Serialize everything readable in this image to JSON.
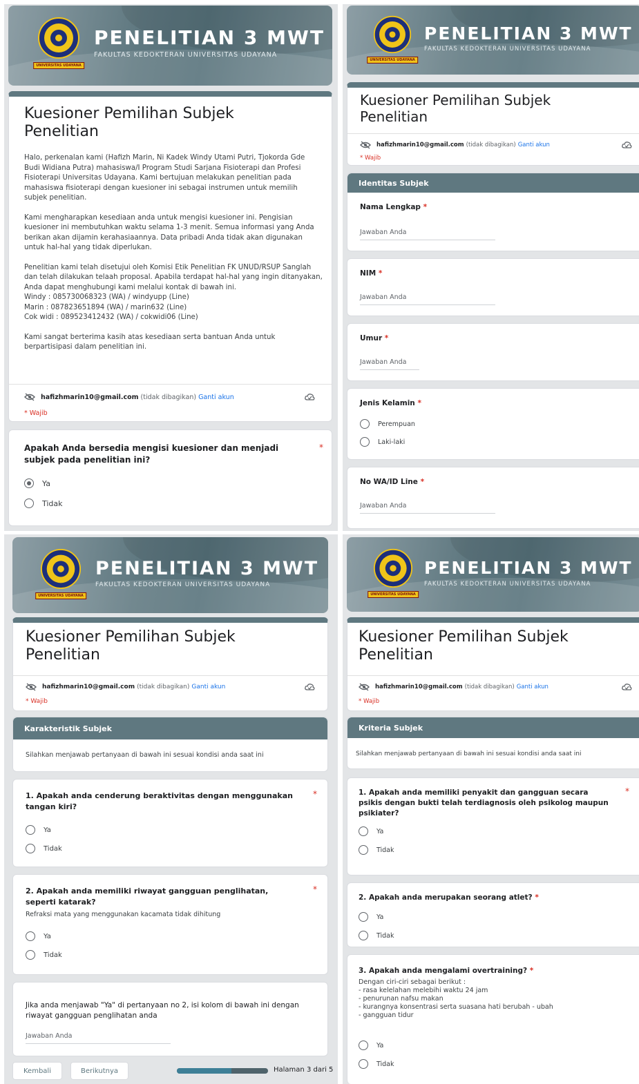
{
  "banner": {
    "title": "PENELITIAN 3 MWT",
    "subtitle": "FAKULTAS KEDOKTERAN UNIVERSITAS UDAYANA",
    "logo_caption": "UNIVERSITAS UDAYANA"
  },
  "form": {
    "title_line1": "Kuesioner Pemilihan Subjek",
    "title_line2": "Penelitian",
    "description": [
      "Halo, perkenalan kami (Hafizh Marin, Ni Kadek Windy Utami Putri, Tjokorda Gde Budi Widiana Putra) mahasiswa/I Program Studi Sarjana Fisioterapi dan Profesi Fisioterapi Universitas Udayana. Kami bertujuan melakukan penelitian pada mahasiswa fisioterapi dengan kuesioner ini sebagai instrumen untuk memilih subjek penelitian.",
      "Kami mengharapkan kesediaan anda untuk mengisi kuesioner ini. Pengisian kuesioner ini membutuhkan waktu selama 1-3 menit. Semua informasi yang Anda berikan akan dijamin kerahasiaannya. Data pribadi Anda tidak akan digunakan untuk hal-hal yang tidak diperlukan.",
      "Penelitian kami telah disetujui oleh Komisi Etik Penelitian FK UNUD/RSUP Sanglah dan telah dilakukan telaah proposal. Apabila terdapat hal-hal yang ingin ditanyakan, Anda dapat menghubungi kami melalui kontak di bawah ini.",
      "Kami sangat berterima kasih atas kesediaan serta bantuan Anda untuk berpartisipasi dalam penelitian ini."
    ],
    "contacts": [
      "Windy : 085730068323 (WA) / windyupp (Line)",
      "Marin : 087823651894 (WA) / marin632 (Line)",
      "Cok widi : 089523412432 (WA) / cokwidi06 (Line)"
    ]
  },
  "account": {
    "email": "hafizhmarin10@gmail.com",
    "not_shared": "(tidak dibagikan)",
    "switch_link": "Ganti akun",
    "required_note": "* Wajib"
  },
  "common": {
    "answer_placeholder": "Jawaban Anda",
    "opt_yes": "Ya",
    "opt_no": "Tidak",
    "req_mark": "*"
  },
  "page1": {
    "consent_question": "Apakah Anda bersedia mengisi kuesioner dan menjadi subjek pada penelitian ini?",
    "selected": "Ya"
  },
  "page2": {
    "section": "Identitas Subjek",
    "fields": [
      {
        "label": "Nama Lengkap"
      },
      {
        "label": "NIM"
      },
      {
        "label": "Umur"
      },
      {
        "label": "Jenis Kelamin",
        "options": [
          "Perempuan",
          "Laki-laki"
        ]
      },
      {
        "label": "No WA/ID Line"
      }
    ]
  },
  "page3": {
    "section": "Karakteristik Subjek",
    "instruction": "Silahkan menjawab pertanyaan di bawah ini sesuai kondisi anda saat ini",
    "q1": "1. Apakah anda cenderung beraktivitas dengan menggunakan tangan kiri?",
    "q2": "2. Apakah anda memiliki riwayat gangguan penglihatan, seperti katarak?",
    "q2_help": "Refraksi mata yang menggunakan kacamata tidak dihitung",
    "q3": "Jika anda menjawab \"Ya\" di pertanyaan no 2, isi kolom di bawah ini dengan riwayat gangguan penglihatan anda",
    "back_button": "Kembali",
    "next_button": "Berikutnya",
    "progress": 0.6,
    "page_label": "Halaman 3 dari 5"
  },
  "page4": {
    "section": "Kriteria Subjek",
    "instruction": "Silahkan menjawab pertanyaan di bawah ini sesuai kondisi anda saat ini",
    "q1": "1. Apakah anda memiliki penyakit dan gangguan secara psikis dengan bukti telah terdiagnosis oleh psikolog maupun psikiater?",
    "q2": "2. Apakah anda merupakan seorang atlet?",
    "q3": "3. Apakah anda mengalami overtraining?",
    "q3_help": [
      "Dengan ciri-ciri sebagai berikut :",
      "- rasa kelelahan melebihi waktu 24 jam",
      "- penurunan nafsu makan",
      "- kurangnya konsentrasi serta suasana hati berubah - ubah",
      "- gangguan tidur"
    ]
  },
  "colors": {
    "theme": "#5f7880",
    "required": "#d93025",
    "link": "#1a73e8",
    "background": "#e3e5e7"
  }
}
